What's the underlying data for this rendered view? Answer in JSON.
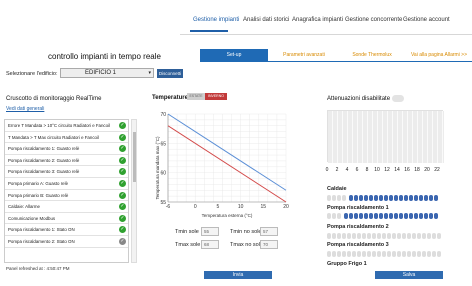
{
  "nav": [
    {
      "label": "Gestione impianti",
      "active": true
    },
    {
      "label": "Analisi dati storici",
      "active": false
    },
    {
      "label": "Anagrafica impianti",
      "active": false
    },
    {
      "label": "Gestione concorrente",
      "active": false
    },
    {
      "label": "Gestione account",
      "active": false
    }
  ],
  "page_title": "controllo impianti in tempo reale",
  "tabs": [
    {
      "label": "Set-up",
      "active": true
    },
    {
      "label": "Parametri avanzati",
      "active": false
    },
    {
      "label": "Sonde Thermolux",
      "active": false
    },
    {
      "label": "Vai alla pagina Allarmi >>",
      "active": false
    }
  ],
  "building": {
    "label": "Selezionare l'edificio:",
    "value": "EDIFICIO 1",
    "button": "Disconnetti"
  },
  "monitor": {
    "title": "Cruscotto di monitoraggio RealTime",
    "link": "Vedi dati generali",
    "rows": [
      "Errore T Mandata > 10°C circuito Radiatori e Fancoil",
      "T Mandata > T Max circuito Radiatori e Fancoil",
      "Pompa riscaldamento 1: Guasto relè",
      "Pompa riscaldamento 2: Guasto relè",
      "Pompa riscaldamento 3: Guasto relè",
      "Pompa primario A: Guasto relè",
      "Pompa primario B: Guasto relè",
      "Caldaie: Allarme",
      "Comunicazione Modbus",
      "Pompa riscaldamento 1: Stato ON",
      "Pompa riscaldamento 2: Stato ON"
    ],
    "refresh": "Panel refreshed at : 4:50:47 PM"
  },
  "temperature": {
    "title": "Temperature",
    "toggle_left": "ESTATE",
    "toggle_right": "INVERNO",
    "tmin_sole_label": "Tmin sole",
    "tmin_sole": "55",
    "tmin_nosole_label": "Tmin no sole",
    "tmin_nosole": "57",
    "tmax_sole_label": "Tmax sole",
    "tmax_sole": "68",
    "tmax_nosole_label": "Tmax no sole",
    "tmax_nosole": "70",
    "send_button": "Invia"
  },
  "chart_data": {
    "type": "line",
    "xlabel": "Temperatura esterna (°C)",
    "ylabel": "Temperatura mandata max (°C)",
    "xlim": [
      -6,
      20
    ],
    "ylim": [
      55,
      70
    ],
    "xticks": [
      "-6",
      "0",
      "5",
      "10",
      "15",
      "20"
    ],
    "yticks": [
      "70",
      "65",
      "60",
      "55"
    ],
    "series": [
      {
        "color": "#5b8fd6",
        "x": [
          -6,
          20
        ],
        "y": [
          70,
          57
        ]
      },
      {
        "color": "#d34a4a",
        "x": [
          -6,
          20
        ],
        "y": [
          68,
          55
        ]
      }
    ]
  },
  "attenuation": {
    "title": "Attenuazioni disabilitate",
    "hours": [
      "0",
      "2",
      "4",
      "6",
      "8",
      "10",
      "12",
      "14",
      "16",
      "18",
      "20",
      "22"
    ]
  },
  "devices": [
    {
      "label": "Caldaie"
    },
    {
      "label": "Pompa riscaldamento 1"
    },
    {
      "label": "Pompa riscaldamento 2"
    },
    {
      "label": "Pompa riscaldamento 3"
    },
    {
      "label": "Gruppo Frigo 1"
    }
  ],
  "save_button": "Salva"
}
